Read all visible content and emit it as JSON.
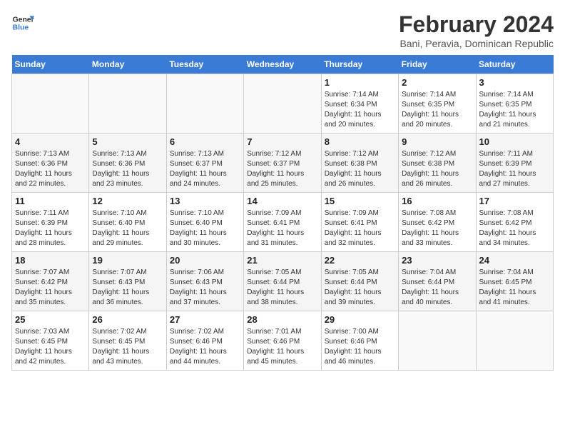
{
  "header": {
    "logo_line1": "General",
    "logo_line2": "Blue",
    "title": "February 2024",
    "subtitle": "Bani, Peravia, Dominican Republic"
  },
  "calendar": {
    "days_of_week": [
      "Sunday",
      "Monday",
      "Tuesday",
      "Wednesday",
      "Thursday",
      "Friday",
      "Saturday"
    ],
    "weeks": [
      [
        {
          "day": "",
          "info": ""
        },
        {
          "day": "",
          "info": ""
        },
        {
          "day": "",
          "info": ""
        },
        {
          "day": "",
          "info": ""
        },
        {
          "day": "1",
          "info": "Sunrise: 7:14 AM\nSunset: 6:34 PM\nDaylight: 11 hours\nand 20 minutes."
        },
        {
          "day": "2",
          "info": "Sunrise: 7:14 AM\nSunset: 6:35 PM\nDaylight: 11 hours\nand 20 minutes."
        },
        {
          "day": "3",
          "info": "Sunrise: 7:14 AM\nSunset: 6:35 PM\nDaylight: 11 hours\nand 21 minutes."
        }
      ],
      [
        {
          "day": "4",
          "info": "Sunrise: 7:13 AM\nSunset: 6:36 PM\nDaylight: 11 hours\nand 22 minutes."
        },
        {
          "day": "5",
          "info": "Sunrise: 7:13 AM\nSunset: 6:36 PM\nDaylight: 11 hours\nand 23 minutes."
        },
        {
          "day": "6",
          "info": "Sunrise: 7:13 AM\nSunset: 6:37 PM\nDaylight: 11 hours\nand 24 minutes."
        },
        {
          "day": "7",
          "info": "Sunrise: 7:12 AM\nSunset: 6:37 PM\nDaylight: 11 hours\nand 25 minutes."
        },
        {
          "day": "8",
          "info": "Sunrise: 7:12 AM\nSunset: 6:38 PM\nDaylight: 11 hours\nand 26 minutes."
        },
        {
          "day": "9",
          "info": "Sunrise: 7:12 AM\nSunset: 6:38 PM\nDaylight: 11 hours\nand 26 minutes."
        },
        {
          "day": "10",
          "info": "Sunrise: 7:11 AM\nSunset: 6:39 PM\nDaylight: 11 hours\nand 27 minutes."
        }
      ],
      [
        {
          "day": "11",
          "info": "Sunrise: 7:11 AM\nSunset: 6:39 PM\nDaylight: 11 hours\nand 28 minutes."
        },
        {
          "day": "12",
          "info": "Sunrise: 7:10 AM\nSunset: 6:40 PM\nDaylight: 11 hours\nand 29 minutes."
        },
        {
          "day": "13",
          "info": "Sunrise: 7:10 AM\nSunset: 6:40 PM\nDaylight: 11 hours\nand 30 minutes."
        },
        {
          "day": "14",
          "info": "Sunrise: 7:09 AM\nSunset: 6:41 PM\nDaylight: 11 hours\nand 31 minutes."
        },
        {
          "day": "15",
          "info": "Sunrise: 7:09 AM\nSunset: 6:41 PM\nDaylight: 11 hours\nand 32 minutes."
        },
        {
          "day": "16",
          "info": "Sunrise: 7:08 AM\nSunset: 6:42 PM\nDaylight: 11 hours\nand 33 minutes."
        },
        {
          "day": "17",
          "info": "Sunrise: 7:08 AM\nSunset: 6:42 PM\nDaylight: 11 hours\nand 34 minutes."
        }
      ],
      [
        {
          "day": "18",
          "info": "Sunrise: 7:07 AM\nSunset: 6:42 PM\nDaylight: 11 hours\nand 35 minutes."
        },
        {
          "day": "19",
          "info": "Sunrise: 7:07 AM\nSunset: 6:43 PM\nDaylight: 11 hours\nand 36 minutes."
        },
        {
          "day": "20",
          "info": "Sunrise: 7:06 AM\nSunset: 6:43 PM\nDaylight: 11 hours\nand 37 minutes."
        },
        {
          "day": "21",
          "info": "Sunrise: 7:05 AM\nSunset: 6:44 PM\nDaylight: 11 hours\nand 38 minutes."
        },
        {
          "day": "22",
          "info": "Sunrise: 7:05 AM\nSunset: 6:44 PM\nDaylight: 11 hours\nand 39 minutes."
        },
        {
          "day": "23",
          "info": "Sunrise: 7:04 AM\nSunset: 6:44 PM\nDaylight: 11 hours\nand 40 minutes."
        },
        {
          "day": "24",
          "info": "Sunrise: 7:04 AM\nSunset: 6:45 PM\nDaylight: 11 hours\nand 41 minutes."
        }
      ],
      [
        {
          "day": "25",
          "info": "Sunrise: 7:03 AM\nSunset: 6:45 PM\nDaylight: 11 hours\nand 42 minutes."
        },
        {
          "day": "26",
          "info": "Sunrise: 7:02 AM\nSunset: 6:45 PM\nDaylight: 11 hours\nand 43 minutes."
        },
        {
          "day": "27",
          "info": "Sunrise: 7:02 AM\nSunset: 6:46 PM\nDaylight: 11 hours\nand 44 minutes."
        },
        {
          "day": "28",
          "info": "Sunrise: 7:01 AM\nSunset: 6:46 PM\nDaylight: 11 hours\nand 45 minutes."
        },
        {
          "day": "29",
          "info": "Sunrise: 7:00 AM\nSunset: 6:46 PM\nDaylight: 11 hours\nand 46 minutes."
        },
        {
          "day": "",
          "info": ""
        },
        {
          "day": "",
          "info": ""
        }
      ]
    ]
  }
}
